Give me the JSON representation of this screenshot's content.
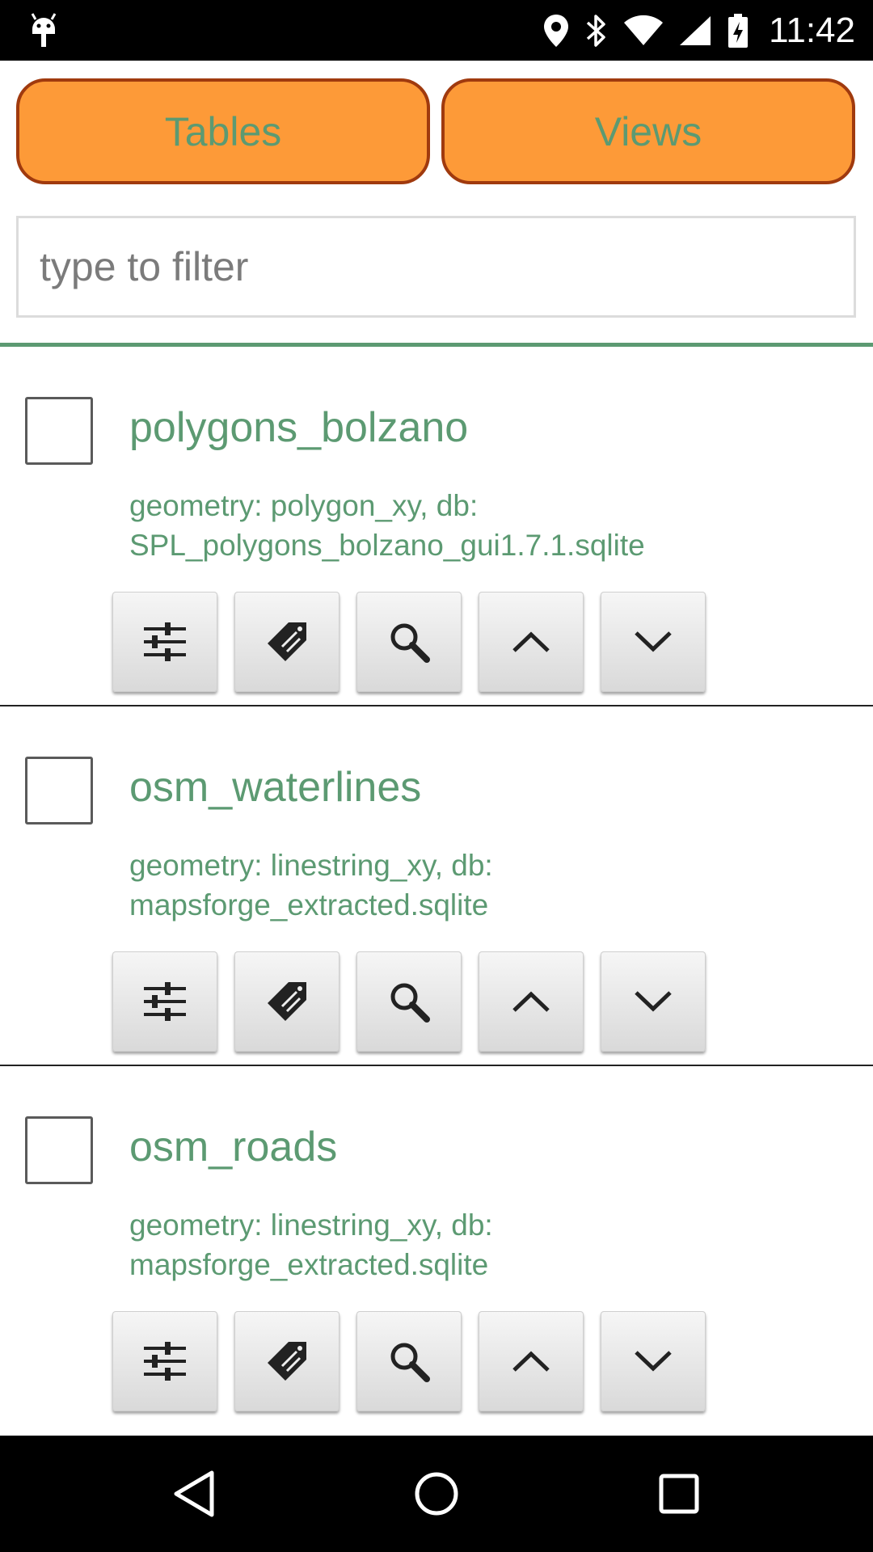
{
  "status_bar": {
    "time": "11:42",
    "left_icon": "android-debug-icon",
    "icons": [
      "location-icon",
      "bluetooth-icon",
      "wifi-icon",
      "signal-icon",
      "battery-charging-icon"
    ]
  },
  "tabs": {
    "tables_label": "Tables",
    "views_label": "Views"
  },
  "filter": {
    "placeholder": "type to filter",
    "value": ""
  },
  "items": [
    {
      "title": "polygons_bolzano",
      "desc_line1": "geometry: polygon_xy, db:",
      "desc_line2": "SPL_polygons_bolzano_gui1.7.1.sqlite",
      "checked": false
    },
    {
      "title": "osm_waterlines",
      "desc_line1": "geometry: linestring_xy, db:",
      "desc_line2": "mapsforge_extracted.sqlite",
      "checked": false
    },
    {
      "title": "osm_roads",
      "desc_line1": "geometry: linestring_xy, db:",
      "desc_line2": "mapsforge_extracted.sqlite",
      "checked": false
    }
  ],
  "item_actions": [
    "sliders-icon",
    "tag-edit-icon",
    "search-icon",
    "chevron-up-icon",
    "chevron-down-icon"
  ],
  "colors": {
    "accent_green": "#5c9a72",
    "tab_orange": "#fd9a38",
    "tab_border": "#a03a0e"
  },
  "nav_bar": {
    "icons": [
      "back-icon",
      "home-icon",
      "recents-icon"
    ]
  }
}
